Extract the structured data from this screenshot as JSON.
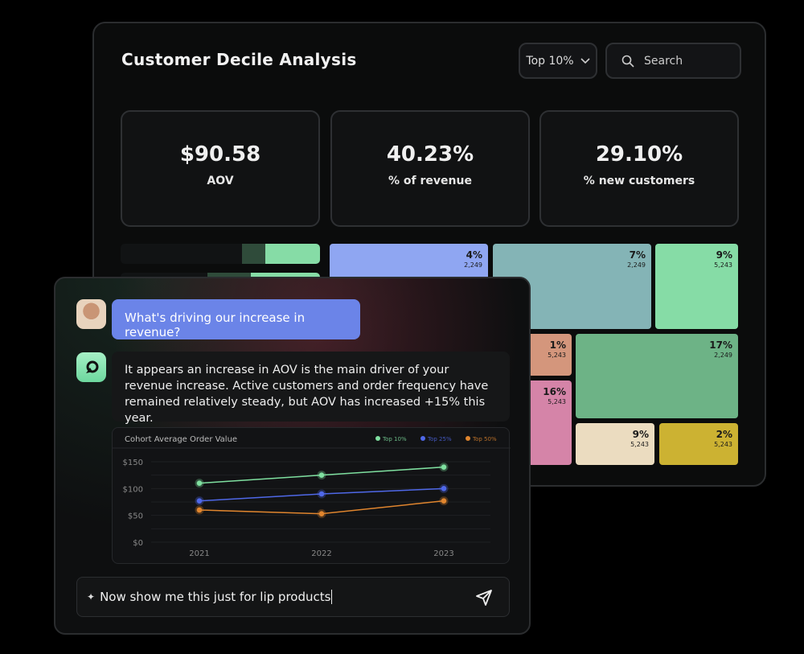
{
  "dashboard": {
    "title": "Customer Decile Analysis",
    "filter": {
      "selected": "Top 10%"
    },
    "search": {
      "placeholder": "Search",
      "icon": "search-icon"
    },
    "kpis": [
      {
        "value": "$90.58",
        "label": "AOV"
      },
      {
        "value": "40.23%",
        "label": "% of revenue"
      },
      {
        "value": "29.10%",
        "label": "% new customers"
      }
    ],
    "treemap": [
      {
        "percent": "4%",
        "count": "2,249",
        "color": "#8fa6f2"
      },
      {
        "percent": "7%",
        "count": "2,249",
        "color": "#84b4b6"
      },
      {
        "percent": "9%",
        "count": "5,243",
        "color": "#86dca6"
      },
      {
        "percent": "1%",
        "count": "5,243",
        "color": "#d4967c"
      },
      {
        "percent": "16%",
        "count": "5,243",
        "color": "#d584a8"
      },
      {
        "percent": "17%",
        "count": "2,249",
        "color": "#6db386"
      },
      {
        "percent": "9%",
        "count": "5,243",
        "color": "#ebdcc0"
      },
      {
        "percent": "2%",
        "count": "5,243",
        "color": "#ccb232"
      }
    ]
  },
  "chat": {
    "user_message": "What's driving our increase in revenue?",
    "assistant_message": "It appears an increase in AOV is the main driver of your revenue increase. Active customers and order frequency have remained relatively steady, but AOV has increased +15% this year.",
    "input_value": "Now show me this just for lip products",
    "accent": "#6b84e8"
  },
  "chart_data": {
    "type": "line",
    "title": "Cohort Average Order Value",
    "x": [
      "2021",
      "2022",
      "2023"
    ],
    "yticks": [
      "$0",
      "$50",
      "$100",
      "$150"
    ],
    "ylim": [
      0,
      150
    ],
    "grid": true,
    "legend": "top-right",
    "series": [
      {
        "name": "Top 10%",
        "values": [
          110,
          125,
          140
        ],
        "color": "#7fe0a0"
      },
      {
        "name": "Top 25%",
        "values": [
          77,
          90,
          100
        ],
        "color": "#4f68e8"
      },
      {
        "name": "Top 50%",
        "values": [
          60,
          53,
          77
        ],
        "color": "#e0852e"
      }
    ]
  }
}
